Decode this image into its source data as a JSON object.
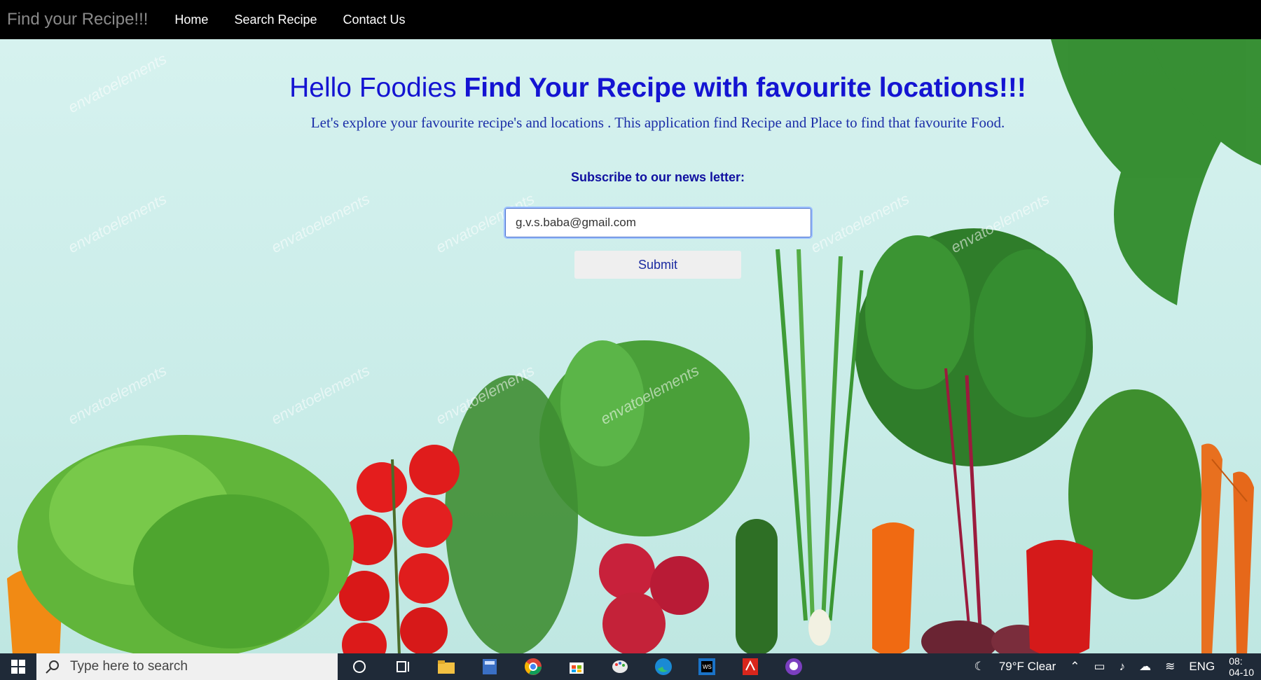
{
  "navbar": {
    "brand": "Find your Recipe!!!",
    "links": [
      "Home",
      "Search Recipe",
      "Contact Us"
    ]
  },
  "hero": {
    "title_light": "Hello Foodies ",
    "title_bold": "Find Your Recipe with favourite locations!!!",
    "subtitle": "Let's explore your favourite recipe's and locations . This application find Recipe and Place to find that favourite Food.",
    "watermark": "envatoelements"
  },
  "newsletter": {
    "label": "Subscribe to our news letter:",
    "email_value": "g.v.s.baba@gmail.com",
    "submit_label": "Submit"
  },
  "taskbar": {
    "search_placeholder": "Type here to search",
    "weather": "79°F  Clear",
    "language": "ENG",
    "time": "08:",
    "date": "04-10"
  },
  "colors": {
    "navbar_bg": "#000000",
    "title": "#1414d2",
    "taskbar_bg": "#1f2a38"
  }
}
